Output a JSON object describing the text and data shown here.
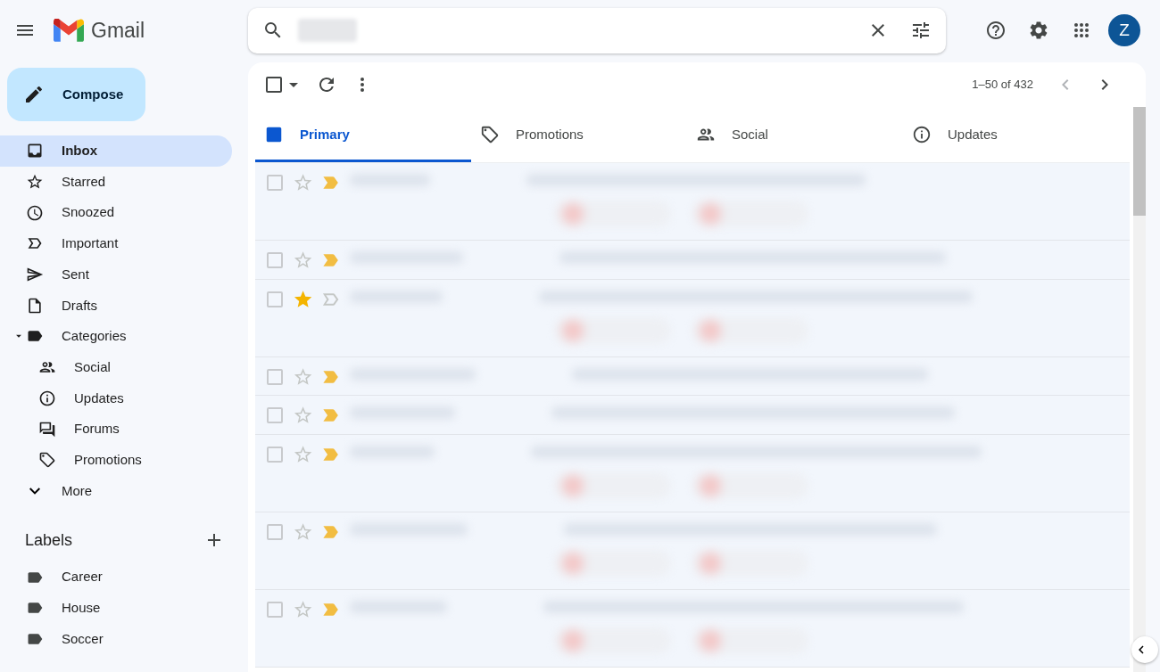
{
  "header": {
    "app_name": "Gmail",
    "avatar_letter": "Z"
  },
  "compose": {
    "label": "Compose"
  },
  "nav": [
    {
      "label": "Inbox",
      "selected": true
    },
    {
      "label": "Starred",
      "selected": false
    },
    {
      "label": "Snoozed",
      "selected": false
    },
    {
      "label": "Important",
      "selected": false
    },
    {
      "label": "Sent",
      "selected": false
    },
    {
      "label": "Drafts",
      "selected": false
    },
    {
      "label": "Categories",
      "selected": false,
      "expanded": true,
      "children": [
        {
          "label": "Social",
          "selected": false
        },
        {
          "label": "Updates",
          "selected": false
        },
        {
          "label": "Forums",
          "selected": false
        },
        {
          "label": "Promotions",
          "selected": false
        }
      ]
    },
    {
      "label": "More",
      "selected": false
    }
  ],
  "labels_section": {
    "title": "Labels",
    "items": [
      {
        "label": "Career"
      },
      {
        "label": "House"
      },
      {
        "label": "Soccer"
      }
    ]
  },
  "toolbar": {
    "select_all_checked": false,
    "page_range": "1–50 of 432"
  },
  "tabs": [
    {
      "label": "Primary",
      "selected": true
    },
    {
      "label": "Promotions",
      "selected": false
    },
    {
      "label": "Social",
      "selected": false
    },
    {
      "label": "Updates",
      "selected": false
    }
  ],
  "emails": [
    {
      "checked": false,
      "starred": false,
      "important": true,
      "has_attachments": true
    },
    {
      "checked": false,
      "starred": false,
      "important": true,
      "has_attachments": false
    },
    {
      "checked": false,
      "starred": true,
      "important": false,
      "has_attachments": true
    },
    {
      "checked": false,
      "starred": false,
      "important": true,
      "has_attachments": false
    },
    {
      "checked": false,
      "starred": false,
      "important": true,
      "has_attachments": false
    },
    {
      "checked": false,
      "starred": false,
      "important": true,
      "has_attachments": true
    },
    {
      "checked": false,
      "starred": false,
      "important": true,
      "has_attachments": true
    },
    {
      "checked": false,
      "starred": false,
      "important": true,
      "has_attachments": true
    }
  ]
}
